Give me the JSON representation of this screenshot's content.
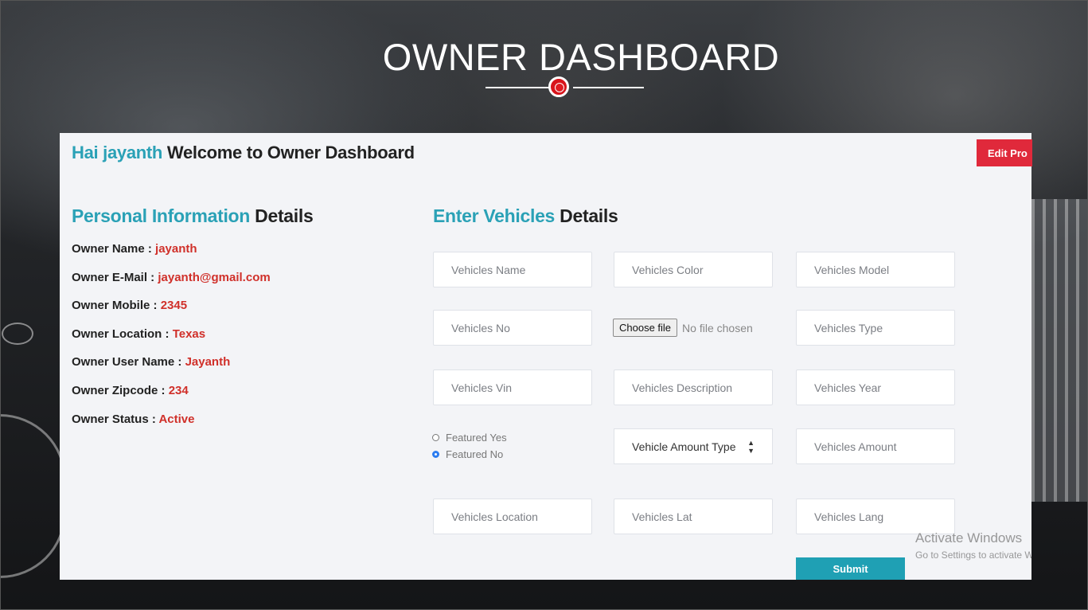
{
  "header": {
    "title": "OWNER DASHBOARD"
  },
  "welcome": {
    "greeting": "Hai jayanth",
    "text": "Welcome to Owner Dashboard"
  },
  "edit_profile_label": "Edit Pro",
  "personal": {
    "heading_accent": "Personal Information",
    "heading_rest": "Details",
    "rows": [
      {
        "label": "Owner Name : ",
        "value": "jayanth"
      },
      {
        "label": "Owner E-Mail : ",
        "value": "jayanth@gmail.com"
      },
      {
        "label": "Owner Mobile : ",
        "value": "2345"
      },
      {
        "label": "Owner Location : ",
        "value": "Texas"
      },
      {
        "label": "Owner User Name : ",
        "value": "Jayanth"
      },
      {
        "label": "Owner Zipcode : ",
        "value": "234"
      },
      {
        "label": "Owner Status : ",
        "value": "Active"
      }
    ]
  },
  "vehicles": {
    "heading_accent": "Enter Vehicles",
    "heading_rest": "Details",
    "fields": {
      "name": "Vehicles Name",
      "color": "Vehicles Color",
      "model": "Vehicles Model",
      "no": "Vehicles No",
      "type": "Vehicles Type",
      "vin": "Vehicles Vin",
      "description": "Vehicles Description",
      "year": "Vehicles Year",
      "amount": "Vehicles Amount",
      "location": "Vehicles Location",
      "lat": "Vehicles Lat",
      "lang": "Vehicles Lang"
    },
    "file": {
      "button": "Choose file",
      "status": "No file chosen"
    },
    "featured": {
      "yes": "Featured Yes",
      "no": "Featured No",
      "selected": "no"
    },
    "amount_type": "Vehicle Amount Type",
    "submit_label": "Submit"
  },
  "watermark": {
    "title": "Activate Windows",
    "subtitle": "Go to Settings to activate Windows."
  },
  "colors": {
    "accent": "#2aa1b6",
    "value_red": "#d0302a",
    "edit_button": "#e0293b",
    "submit_button": "#1fa0b4",
    "title_dot": "#d8141b"
  }
}
